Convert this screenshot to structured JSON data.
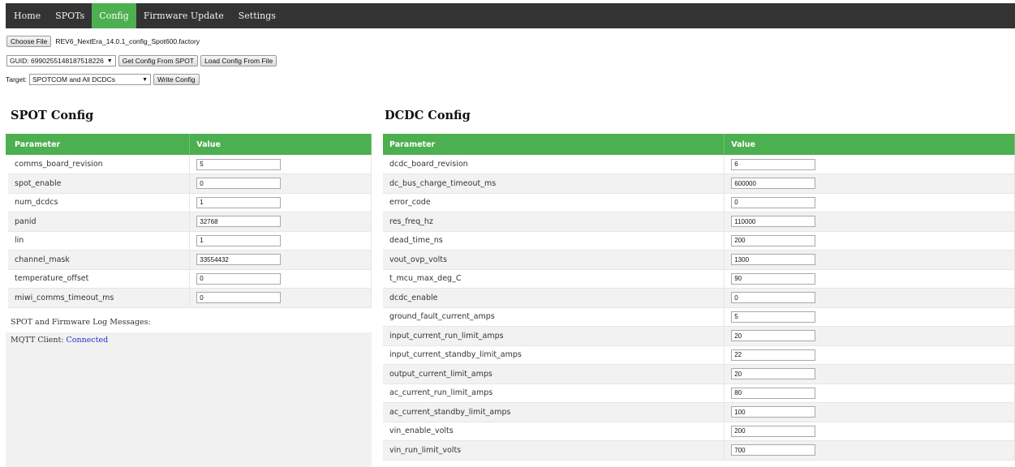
{
  "nav": {
    "items": [
      "Home",
      "SPOTs",
      "Config",
      "Firmware Update",
      "Settings"
    ],
    "active_index": 2,
    "active_color": "#4caf50",
    "bg_color": "#333333"
  },
  "file": {
    "choose_label": "Choose File",
    "filename": "REV6_NextEra_14.0.1_config_Spot600.factory"
  },
  "guid": {
    "selected": "GUID: 6990255148187518226",
    "get_config_label": "Get Config From SPOT",
    "load_config_label": "Load Config From File"
  },
  "target": {
    "label": "Target:",
    "selected": "SPOTCOM and All DCDCs",
    "write_label": "Write Config"
  },
  "spot_config": {
    "title": "SPOT Config",
    "headers": [
      "Parameter",
      "Value"
    ],
    "rows": [
      {
        "param": "comms_board_revision",
        "value": "5"
      },
      {
        "param": "spot_enable",
        "value": "0"
      },
      {
        "param": "num_dcdcs",
        "value": "1"
      },
      {
        "param": "panid",
        "value": "32768"
      },
      {
        "param": "lin",
        "value": "1"
      },
      {
        "param": "channel_mask",
        "value": "33554432"
      },
      {
        "param": "temperature_offset",
        "value": "0"
      },
      {
        "param": "miwi_comms_timeout_ms",
        "value": "0"
      }
    ]
  },
  "dcdc_config": {
    "title": "DCDC Config",
    "headers": [
      "Parameter",
      "Value"
    ],
    "rows": [
      {
        "param": "dcdc_board_revision",
        "value": "6"
      },
      {
        "param": "dc_bus_charge_timeout_ms",
        "value": "600000"
      },
      {
        "param": "error_code",
        "value": "0"
      },
      {
        "param": "res_freq_hz",
        "value": "110000"
      },
      {
        "param": "dead_time_ns",
        "value": "200"
      },
      {
        "param": "vout_ovp_volts",
        "value": "1300"
      },
      {
        "param": "t_mcu_max_deg_C",
        "value": "90"
      },
      {
        "param": "dcdc_enable",
        "value": "0"
      },
      {
        "param": "ground_fault_current_amps",
        "value": "5"
      },
      {
        "param": "input_current_run_limit_amps",
        "value": "20"
      },
      {
        "param": "input_current_standby_limit_amps",
        "value": "22"
      },
      {
        "param": "output_current_limit_amps",
        "value": "20"
      },
      {
        "param": "ac_current_run_limit_amps",
        "value": "80"
      },
      {
        "param": "ac_current_standby_limit_amps",
        "value": "100"
      },
      {
        "param": "vin_enable_volts",
        "value": "200"
      },
      {
        "param": "vin_run_limit_volts",
        "value": "700"
      }
    ]
  },
  "log": {
    "label": "SPOT and Firmware Log Messages:",
    "mqtt_label": "MQTT Client:",
    "mqtt_status": "Connected"
  }
}
